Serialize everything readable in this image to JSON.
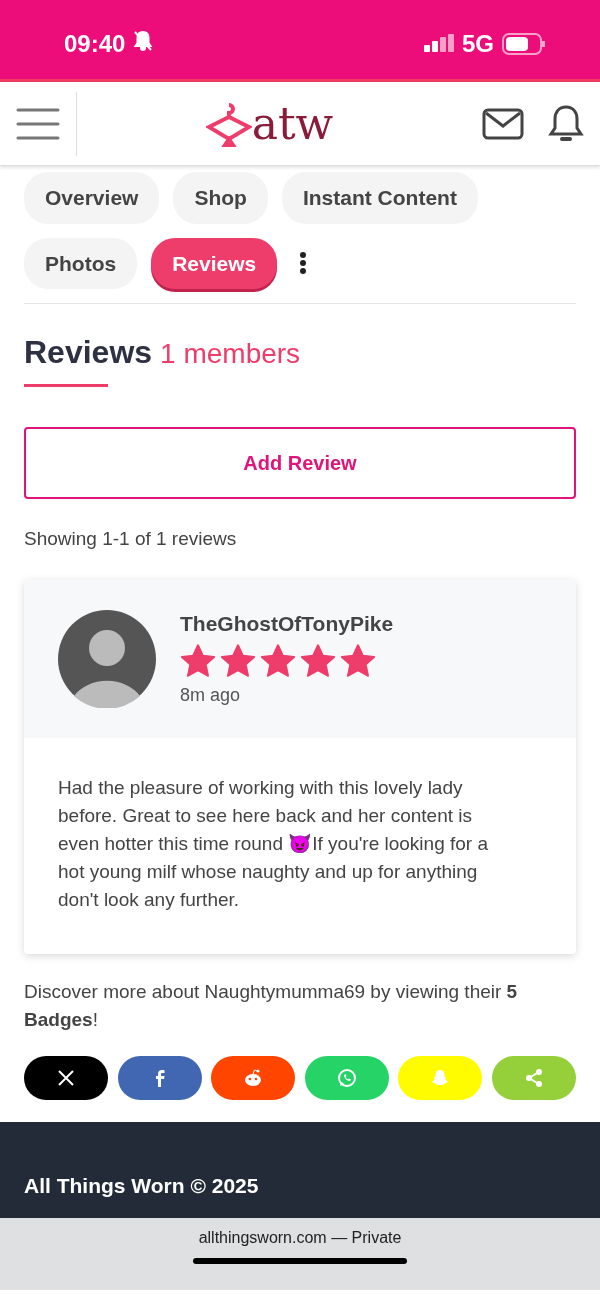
{
  "status_bar": {
    "time": "09:40",
    "network": "5G"
  },
  "logo": "atw",
  "tabs": [
    {
      "label": "Overview",
      "selected": false
    },
    {
      "label": "Shop",
      "selected": false
    },
    {
      "label": "Instant Content",
      "selected": false
    },
    {
      "label": "Photos",
      "selected": false
    },
    {
      "label": "Reviews",
      "selected": true
    }
  ],
  "heading": {
    "title": "Reviews",
    "count": "1 members"
  },
  "add_review_button": "Add Review",
  "showing": "Showing 1-1 of 1 reviews",
  "reviews": [
    {
      "author": "TheGhostOfTonyPike",
      "stars": 5,
      "time": "8m ago",
      "text": "Had the pleasure of working with this lovely lady before. Great to see here back and her content is even hotter this time round 😈If you're looking for a hot young milf whose naughty and up for anything don't look any further."
    }
  ],
  "discover": "Discover more about Naughtymumma69 by viewing their **5 Badges**!",
  "share_buttons": [
    {
      "kind": "x",
      "color": "#000000"
    },
    {
      "kind": "facebook",
      "color": "#4267b2"
    },
    {
      "kind": "reddit",
      "color": "#ff4500"
    },
    {
      "kind": "whatsapp",
      "color": "#25d366"
    },
    {
      "kind": "snapchat",
      "color": "#fffc00"
    },
    {
      "kind": "share",
      "color": "#95d03a"
    }
  ],
  "footer": {
    "copyright": "All Things Worn © 2025"
  },
  "address_bar": {
    "url": "allthingsworn.com — Private"
  }
}
